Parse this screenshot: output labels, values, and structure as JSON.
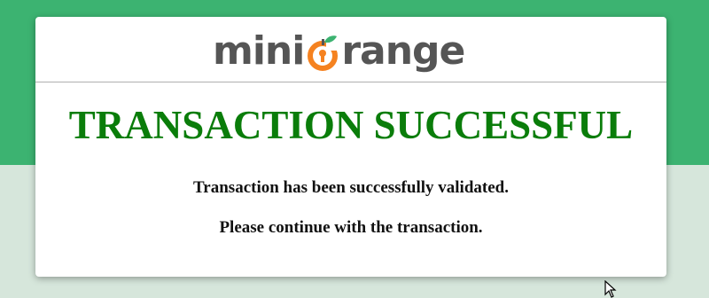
{
  "brand": {
    "logo_text_before": "mini",
    "logo_text_after": "range",
    "logo_icon": "orange-keyhole-icon",
    "colors": {
      "text": "#555555",
      "orange": "#f58220",
      "leaf": "#3cb371"
    }
  },
  "status": {
    "title": "TRANSACTION SUCCESSFUL",
    "title_color": "#0a7d0a",
    "message_1": "Transaction has been successfully validated.",
    "message_2": "Please continue with the transaction."
  },
  "theme": {
    "background_top": "#3cb371",
    "background_bottom": "#d6e6db"
  }
}
